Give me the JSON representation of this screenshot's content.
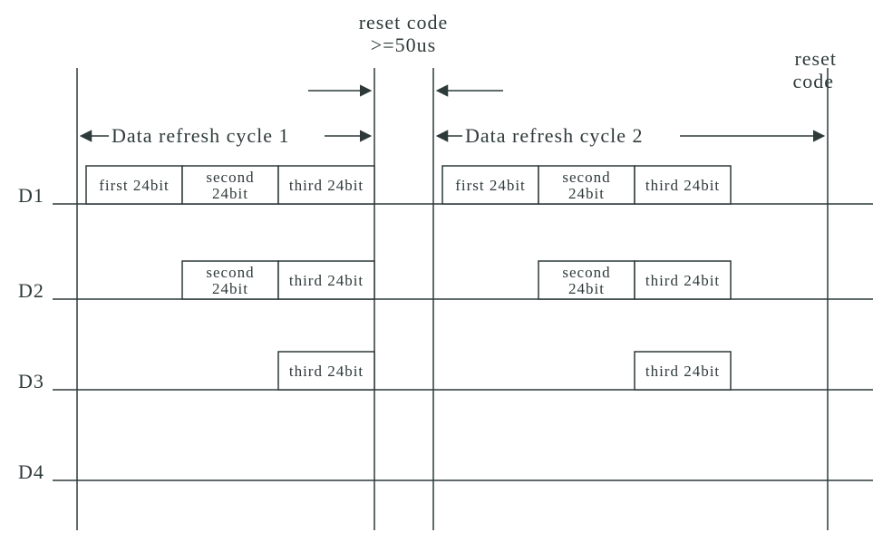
{
  "title_reset_code": "reset code",
  "title_reset_time": ">=50us",
  "title_reset_code2a": "reset",
  "title_reset_code2b": "code",
  "cycle1_label": "Data refresh cycle 1",
  "cycle2_label": "Data refresh cycle 2",
  "rows": {
    "d1": "D1",
    "d2": "D2",
    "d3": "D3",
    "d4": "D4"
  },
  "bits": {
    "first": "first 24bit",
    "second_a": "second",
    "second_b": "24bit",
    "third": "third 24bit"
  },
  "chart_data": {
    "type": "timing-diagram",
    "cycles": 2,
    "reset_gap_min_us": 50,
    "lines": [
      {
        "name": "D1",
        "cycle1": [
          "first 24bit",
          "second 24bit",
          "third 24bit"
        ],
        "cycle2": [
          "first 24bit",
          "second 24bit",
          "third 24bit"
        ]
      },
      {
        "name": "D2",
        "cycle1": [
          "second 24bit",
          "third 24bit"
        ],
        "cycle2": [
          "second 24bit",
          "third 24bit"
        ]
      },
      {
        "name": "D3",
        "cycle1": [
          "third 24bit"
        ],
        "cycle2": [
          "third 24bit"
        ]
      },
      {
        "name": "D4",
        "cycle1": [],
        "cycle2": []
      }
    ]
  }
}
